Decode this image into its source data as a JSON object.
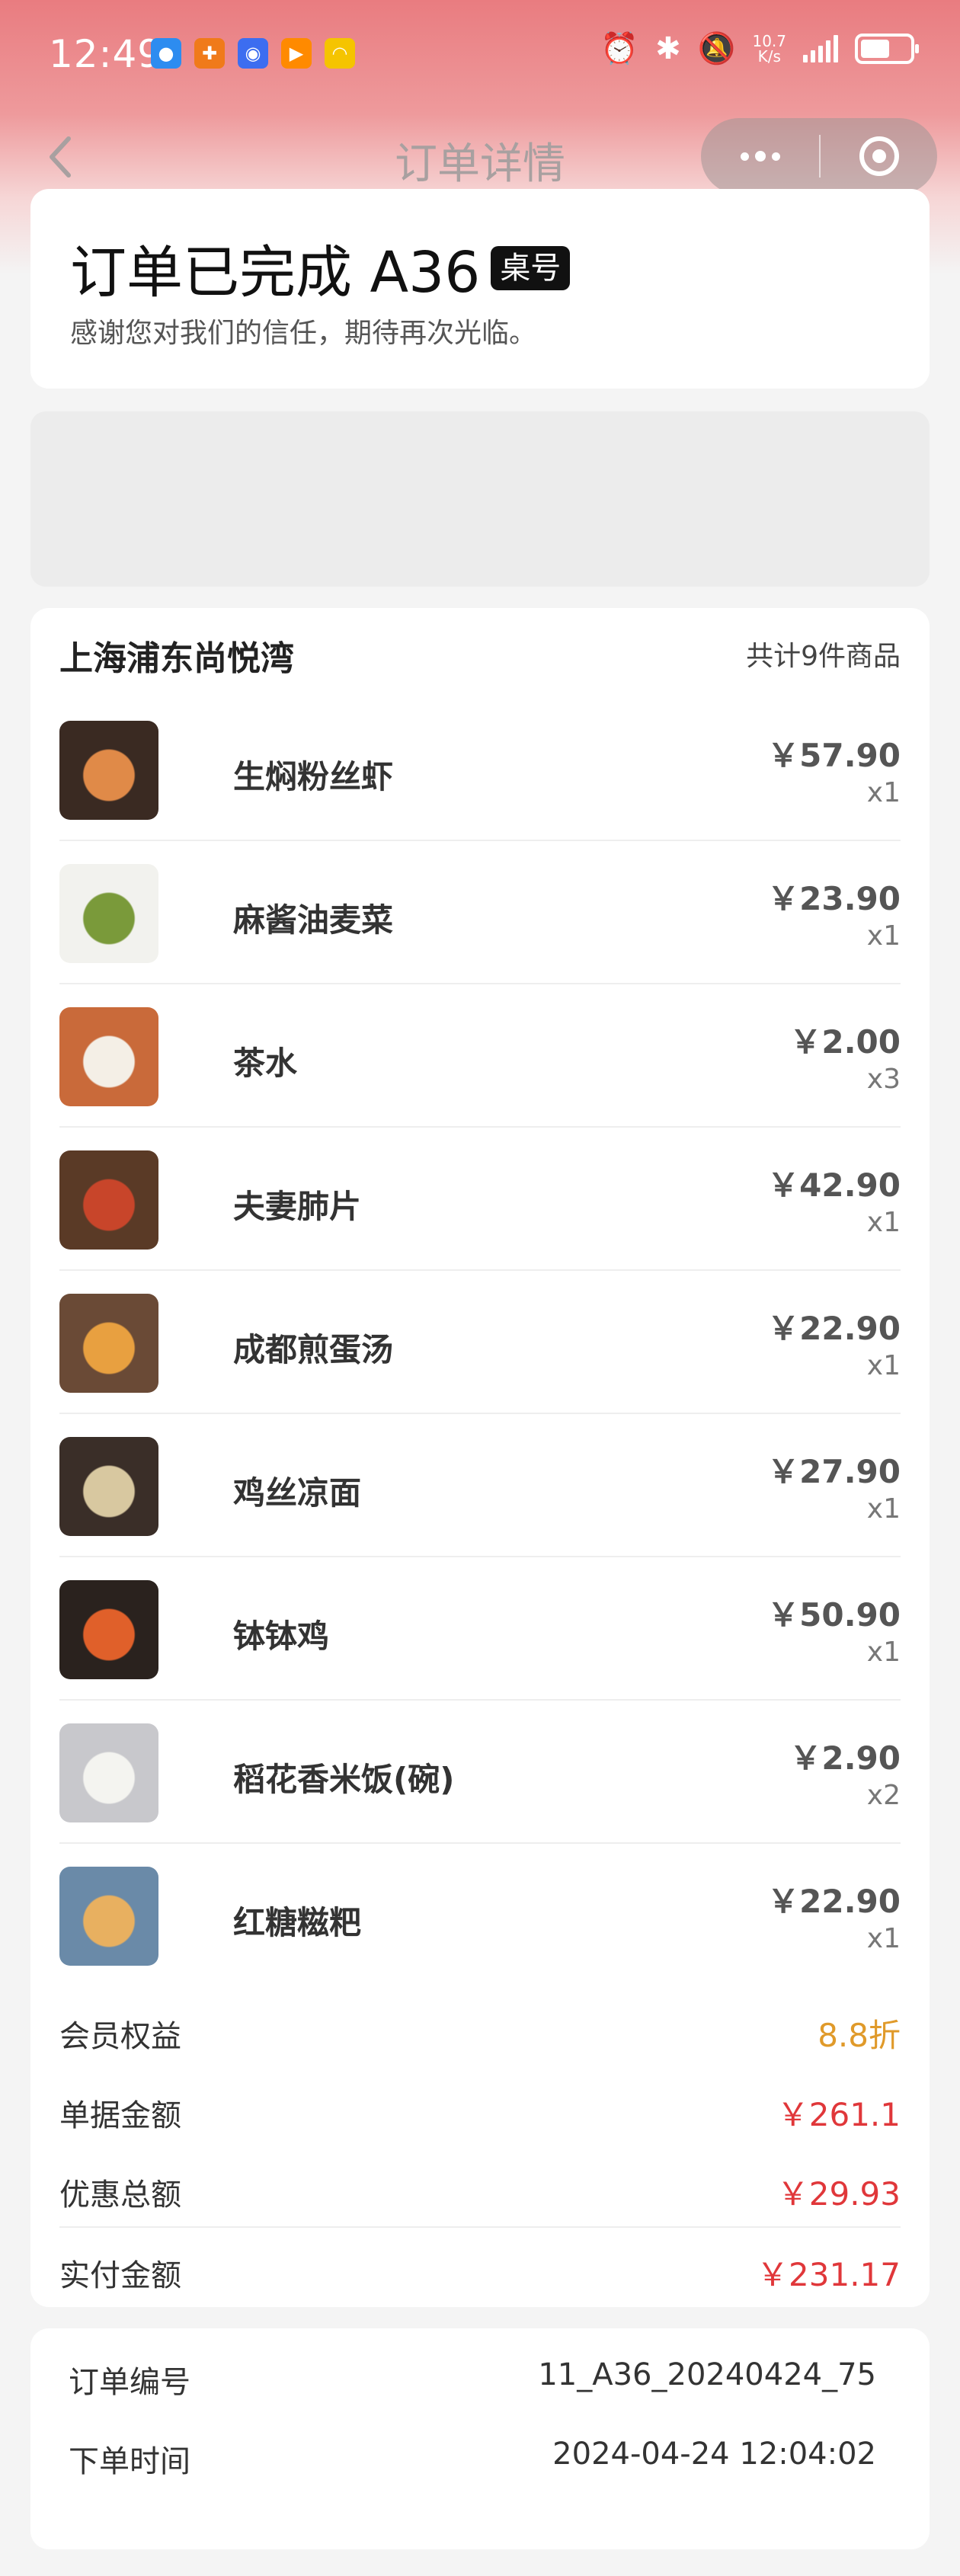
{
  "status_bar": {
    "time": "12:49",
    "net_speed_value": "10.7",
    "net_speed_unit": "K/s",
    "battery_level_percent": 60,
    "notification_icons": [
      {
        "name": "message-icon",
        "color": "#2d8cf0"
      },
      {
        "name": "app-icon-orange",
        "color": "#f07a1a"
      },
      {
        "name": "app-icon-blue",
        "color": "#3c6df0"
      },
      {
        "name": "video-app-icon",
        "color": "#ff8a00"
      },
      {
        "name": "app-icon-yellow",
        "color": "#f5c400"
      }
    ]
  },
  "nav": {
    "title": "订单详情"
  },
  "order_status": {
    "title": "订单已完成 A36",
    "badge": "桌号",
    "subtitle": "感谢您对我们的信任，期待再次光临。"
  },
  "store": {
    "name": "上海浦东尚悦湾",
    "total_count": "共计9件商品"
  },
  "items": [
    {
      "name": "生焖粉丝虾",
      "price": "￥57.90",
      "qty": "x1",
      "thumb_colors": [
        "#3a2a22",
        "#e08a48"
      ]
    },
    {
      "name": "麻酱油麦菜",
      "price": "￥23.90",
      "qty": "x1",
      "thumb_colors": [
        "#f2f2ee",
        "#7a9a3a"
      ]
    },
    {
      "name": "茶水",
      "price": "￥2.00",
      "qty": "x3",
      "thumb_colors": [
        "#c96a3a",
        "#f4efe6"
      ]
    },
    {
      "name": "夫妻肺片",
      "price": "￥42.90",
      "qty": "x1",
      "thumb_colors": [
        "#5a3a26",
        "#c8452a"
      ]
    },
    {
      "name": "成都煎蛋汤",
      "price": "￥22.90",
      "qty": "x1",
      "thumb_colors": [
        "#6a4a36",
        "#e8a040"
      ]
    },
    {
      "name": "鸡丝凉面",
      "price": "￥27.90",
      "qty": "x1",
      "thumb_colors": [
        "#3a2e28",
        "#d8c8a0"
      ]
    },
    {
      "name": "钵钵鸡",
      "price": "￥50.90",
      "qty": "x1",
      "thumb_colors": [
        "#2a221e",
        "#e0602a"
      ]
    },
    {
      "name": "稻花香米饭(碗)",
      "price": "￥2.90",
      "qty": "x2",
      "thumb_colors": [
        "#c8c8cc",
        "#f4f4f0"
      ]
    },
    {
      "name": "红糖糍粑",
      "price": "￥22.90",
      "qty": "x1",
      "thumb_colors": [
        "#6a8aa8",
        "#e8b060"
      ]
    }
  ],
  "summary": {
    "member_label": "会员权益",
    "member_value": "8.8折",
    "bill_label": "单据金额",
    "bill_value": "￥261.1",
    "discount_label": "优惠总额",
    "discount_value": "￥29.93",
    "paid_label": "实付金额",
    "paid_value": "￥231.17"
  },
  "colors": {
    "accent_red": "#e0373a",
    "member_gold": "#e09a2a"
  },
  "order_info": {
    "order_no_label": "订单编号",
    "order_no_value": "11_A36_20240424_75",
    "order_time_label": "下单时间",
    "order_time_value": "2024-04-24 12:04:02"
  }
}
